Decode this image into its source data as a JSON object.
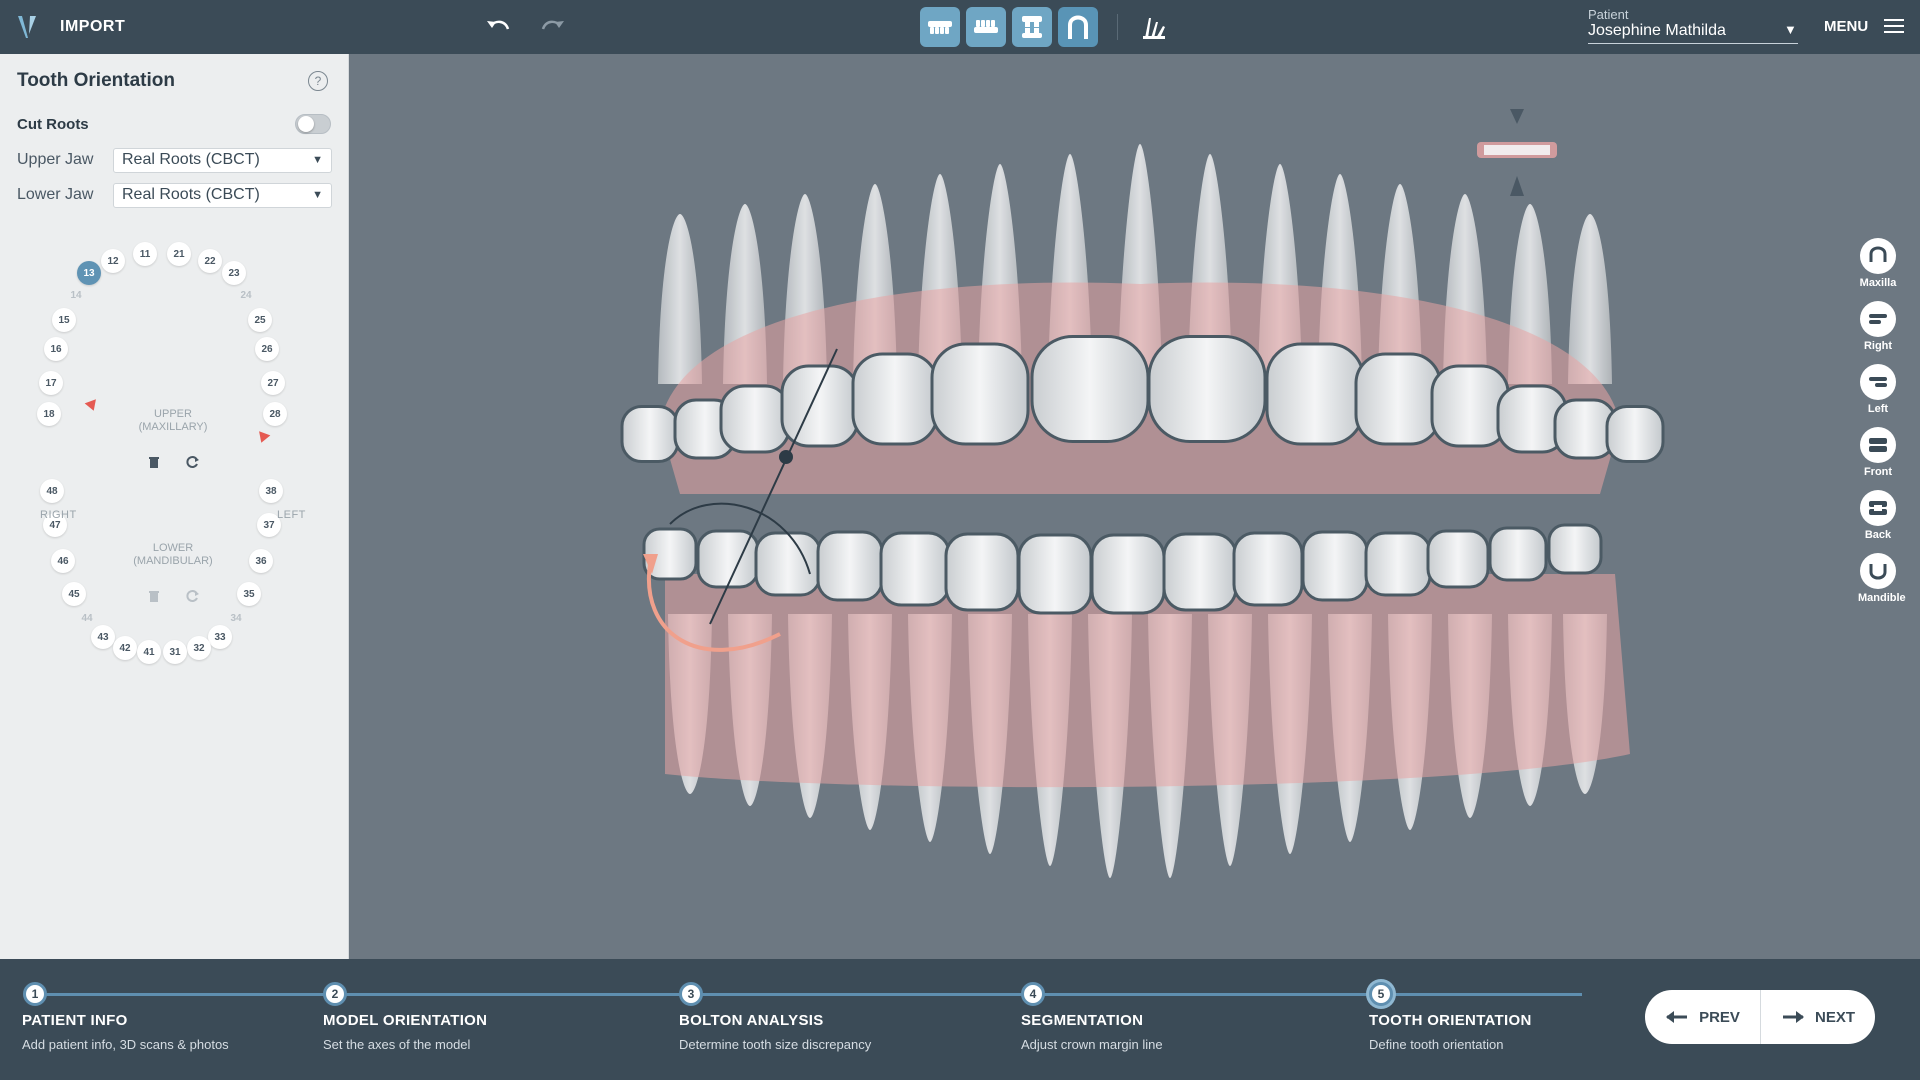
{
  "topbar": {
    "import_label": "IMPORT",
    "patient_label": "Patient",
    "patient_name": "Josephine Mathilda",
    "menu_label": "MENU"
  },
  "panel": {
    "title": "Tooth Orientation",
    "cut_roots_label": "Cut Roots",
    "cut_roots_on": false,
    "upper_jaw_label": "Upper Jaw",
    "upper_jaw_value": "Real Roots (CBCT)",
    "lower_jaw_label": "Lower Jaw",
    "lower_jaw_value": "Real Roots (CBCT)",
    "upper_arch_label_1": "UPPER",
    "upper_arch_label_2": "(MAXILLARY)",
    "lower_arch_label_1": "LOWER",
    "lower_arch_label_2": "(MANDIBULAR)",
    "right_label": "RIGHT",
    "left_label": "LEFT",
    "selected_tooth": "13",
    "upper_teeth": [
      "12",
      "11",
      "21",
      "22",
      "23",
      "13",
      "14",
      "24",
      "15",
      "25",
      "16",
      "26",
      "17",
      "27",
      "18",
      "28"
    ],
    "lower_teeth": [
      "48",
      "38",
      "47",
      "37",
      "46",
      "36",
      "45",
      "35",
      "44",
      "34",
      "43",
      "33",
      "42",
      "32",
      "41",
      "31"
    ]
  },
  "view_buttons": [
    {
      "label": "Maxilla",
      "icon": "maxilla-icon"
    },
    {
      "label": "Right",
      "icon": "right-view-icon"
    },
    {
      "label": "Left",
      "icon": "left-view-icon"
    },
    {
      "label": "Front",
      "icon": "front-view-icon"
    },
    {
      "label": "Back",
      "icon": "back-view-icon"
    },
    {
      "label": "Mandible",
      "icon": "mandible-icon"
    }
  ],
  "steps": [
    {
      "num": "1",
      "title": "PATIENT INFO",
      "sub": "Add patient info, 3D scans & photos"
    },
    {
      "num": "2",
      "title": "MODEL ORIENTATION",
      "sub": "Set the axes of the model"
    },
    {
      "num": "3",
      "title": "BOLTON ANALYSIS",
      "sub": "Determine tooth size discrepancy"
    },
    {
      "num": "4",
      "title": "SEGMENTATION",
      "sub": "Adjust crown margin line"
    },
    {
      "num": "5",
      "title": "TOOTH ORIENTATION",
      "sub": "Define tooth orientation"
    }
  ],
  "nav": {
    "prev_label": "PREV",
    "next_label": "NEXT"
  },
  "colors": {
    "accent": "#5f93b4",
    "topbar": "#3b4b57",
    "gum": "#e8a4a4",
    "arrow": "#f0a08c"
  }
}
